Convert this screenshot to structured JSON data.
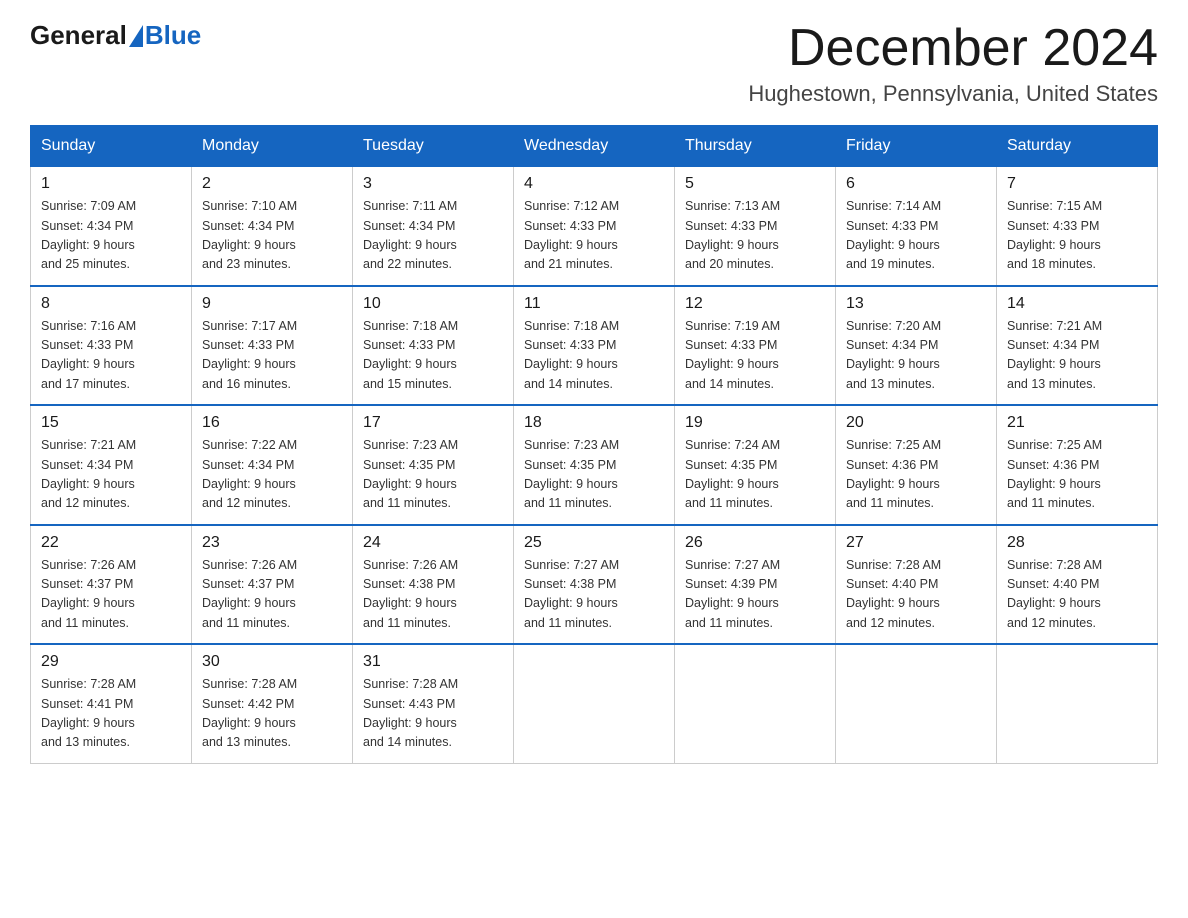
{
  "header": {
    "logo": {
      "general": "General",
      "blue": "Blue"
    },
    "title": "December 2024",
    "location": "Hughestown, Pennsylvania, United States"
  },
  "weekdays": [
    "Sunday",
    "Monday",
    "Tuesday",
    "Wednesday",
    "Thursday",
    "Friday",
    "Saturday"
  ],
  "weeks": [
    [
      {
        "day": "1",
        "sunrise": "7:09 AM",
        "sunset": "4:34 PM",
        "daylight": "9 hours and 25 minutes."
      },
      {
        "day": "2",
        "sunrise": "7:10 AM",
        "sunset": "4:34 PM",
        "daylight": "9 hours and 23 minutes."
      },
      {
        "day": "3",
        "sunrise": "7:11 AM",
        "sunset": "4:34 PM",
        "daylight": "9 hours and 22 minutes."
      },
      {
        "day": "4",
        "sunrise": "7:12 AM",
        "sunset": "4:33 PM",
        "daylight": "9 hours and 21 minutes."
      },
      {
        "day": "5",
        "sunrise": "7:13 AM",
        "sunset": "4:33 PM",
        "daylight": "9 hours and 20 minutes."
      },
      {
        "day": "6",
        "sunrise": "7:14 AM",
        "sunset": "4:33 PM",
        "daylight": "9 hours and 19 minutes."
      },
      {
        "day": "7",
        "sunrise": "7:15 AM",
        "sunset": "4:33 PM",
        "daylight": "9 hours and 18 minutes."
      }
    ],
    [
      {
        "day": "8",
        "sunrise": "7:16 AM",
        "sunset": "4:33 PM",
        "daylight": "9 hours and 17 minutes."
      },
      {
        "day": "9",
        "sunrise": "7:17 AM",
        "sunset": "4:33 PM",
        "daylight": "9 hours and 16 minutes."
      },
      {
        "day": "10",
        "sunrise": "7:18 AM",
        "sunset": "4:33 PM",
        "daylight": "9 hours and 15 minutes."
      },
      {
        "day": "11",
        "sunrise": "7:18 AM",
        "sunset": "4:33 PM",
        "daylight": "9 hours and 14 minutes."
      },
      {
        "day": "12",
        "sunrise": "7:19 AM",
        "sunset": "4:33 PM",
        "daylight": "9 hours and 14 minutes."
      },
      {
        "day": "13",
        "sunrise": "7:20 AM",
        "sunset": "4:34 PM",
        "daylight": "9 hours and 13 minutes."
      },
      {
        "day": "14",
        "sunrise": "7:21 AM",
        "sunset": "4:34 PM",
        "daylight": "9 hours and 13 minutes."
      }
    ],
    [
      {
        "day": "15",
        "sunrise": "7:21 AM",
        "sunset": "4:34 PM",
        "daylight": "9 hours and 12 minutes."
      },
      {
        "day": "16",
        "sunrise": "7:22 AM",
        "sunset": "4:34 PM",
        "daylight": "9 hours and 12 minutes."
      },
      {
        "day": "17",
        "sunrise": "7:23 AM",
        "sunset": "4:35 PM",
        "daylight": "9 hours and 11 minutes."
      },
      {
        "day": "18",
        "sunrise": "7:23 AM",
        "sunset": "4:35 PM",
        "daylight": "9 hours and 11 minutes."
      },
      {
        "day": "19",
        "sunrise": "7:24 AM",
        "sunset": "4:35 PM",
        "daylight": "9 hours and 11 minutes."
      },
      {
        "day": "20",
        "sunrise": "7:25 AM",
        "sunset": "4:36 PM",
        "daylight": "9 hours and 11 minutes."
      },
      {
        "day": "21",
        "sunrise": "7:25 AM",
        "sunset": "4:36 PM",
        "daylight": "9 hours and 11 minutes."
      }
    ],
    [
      {
        "day": "22",
        "sunrise": "7:26 AM",
        "sunset": "4:37 PM",
        "daylight": "9 hours and 11 minutes."
      },
      {
        "day": "23",
        "sunrise": "7:26 AM",
        "sunset": "4:37 PM",
        "daylight": "9 hours and 11 minutes."
      },
      {
        "day": "24",
        "sunrise": "7:26 AM",
        "sunset": "4:38 PM",
        "daylight": "9 hours and 11 minutes."
      },
      {
        "day": "25",
        "sunrise": "7:27 AM",
        "sunset": "4:38 PM",
        "daylight": "9 hours and 11 minutes."
      },
      {
        "day": "26",
        "sunrise": "7:27 AM",
        "sunset": "4:39 PM",
        "daylight": "9 hours and 11 minutes."
      },
      {
        "day": "27",
        "sunrise": "7:28 AM",
        "sunset": "4:40 PM",
        "daylight": "9 hours and 12 minutes."
      },
      {
        "day": "28",
        "sunrise": "7:28 AM",
        "sunset": "4:40 PM",
        "daylight": "9 hours and 12 minutes."
      }
    ],
    [
      {
        "day": "29",
        "sunrise": "7:28 AM",
        "sunset": "4:41 PM",
        "daylight": "9 hours and 13 minutes."
      },
      {
        "day": "30",
        "sunrise": "7:28 AM",
        "sunset": "4:42 PM",
        "daylight": "9 hours and 13 minutes."
      },
      {
        "day": "31",
        "sunrise": "7:28 AM",
        "sunset": "4:43 PM",
        "daylight": "9 hours and 14 minutes."
      },
      null,
      null,
      null,
      null
    ]
  ]
}
